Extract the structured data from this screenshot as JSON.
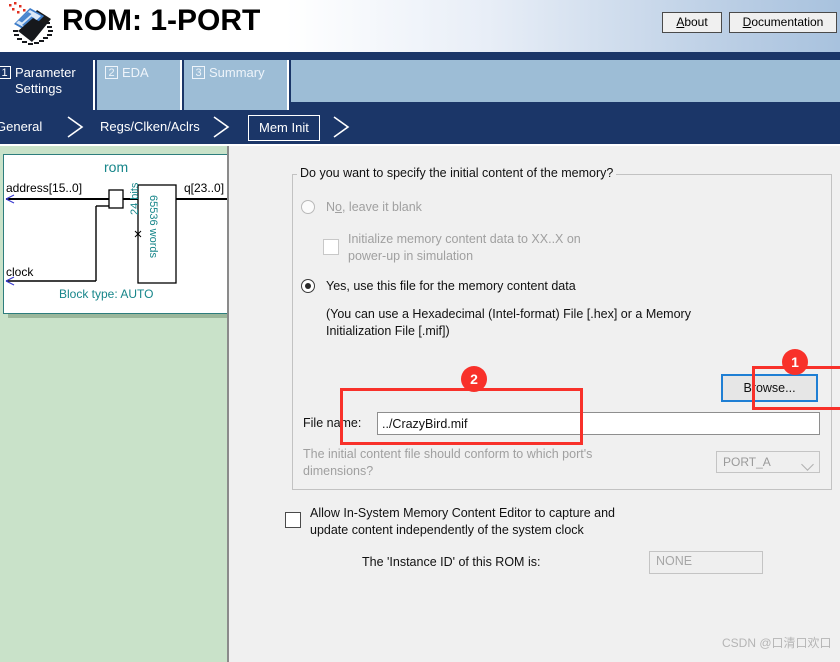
{
  "header": {
    "title": "ROM: 1-PORT",
    "logo_icon": "chip-ic-icon",
    "about_label": "About",
    "about_accel": "A",
    "about_rest": "bout",
    "doc_label": "Documentation",
    "doc_accel": "D",
    "doc_rest": "ocumentation"
  },
  "tabs": [
    {
      "num": "1",
      "label": "Parameter Settings",
      "line1": "Parameter",
      "line2": "Settings",
      "active": true
    },
    {
      "num": "2",
      "label": "EDA",
      "active": false
    },
    {
      "num": "3",
      "label": "Summary",
      "active": false
    }
  ],
  "breadcrumbs": [
    {
      "label": "General",
      "active": false
    },
    {
      "label": "Regs/Clken/Aclrs",
      "active": false
    },
    {
      "label": "Mem Init",
      "active": true
    }
  ],
  "diagram": {
    "block_name": "rom",
    "port_address": "address[15..0]",
    "port_q": "q[23..0]",
    "port_clock": "clock",
    "mem_bits": "24 bits",
    "mem_words": "65536 words",
    "block_type": "Block type: AUTO"
  },
  "group": {
    "title": "Do you want to specify the initial content of the memory?",
    "option_no": "No, leave it blank",
    "option_no_accel": "o",
    "option_no_pre": "N",
    "option_no_post": ", leave it blank",
    "init_xx_line1": "Initialize memory content data to XX..X on",
    "init_xx_line2": "power-up in simulation",
    "option_yes": "Yes, use this file for the memory content data",
    "hint_line1": "(You can use a Hexadecimal (Intel-format) File [.hex] or a Memory",
    "hint_line2": "Initialization File [.mif])",
    "browse_label": "Browse...",
    "filename_label": "File name:",
    "filename_value": "../CrazyBird.mif",
    "conform_line1": "The initial content file should conform to which port's",
    "conform_line2": "dimensions?",
    "port_value": "PORT_A",
    "port_chevron": "chevron-down-icon"
  },
  "bottom": {
    "allow_line1": "Allow In-System Memory Content Editor to capture and",
    "allow_line2": "update content independently of the system clock",
    "instance_label": "The 'Instance ID' of this ROM is:",
    "instance_value": "NONE"
  },
  "annotations": [
    {
      "id": "1",
      "target": "browse-button"
    },
    {
      "id": "2",
      "target": "filename-input"
    }
  ],
  "watermark": "CSDN @口清口欢口",
  "colors": {
    "tab_active_bg": "#1b3668",
    "tab_inactive_bg": "#9dbdd6",
    "left_panel_bg": "#c9e2c9",
    "diagram_teal": "#17868a",
    "annotation_red": "#f8312a",
    "focus_blue": "#1f7fd4"
  }
}
